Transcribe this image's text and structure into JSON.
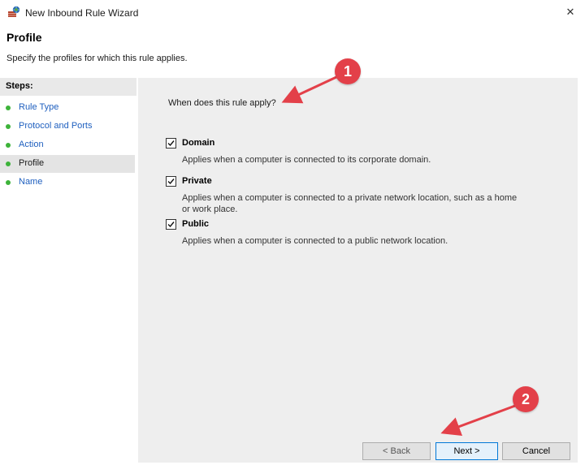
{
  "window": {
    "title": "New Inbound Rule Wizard",
    "close_glyph": "✕"
  },
  "page": {
    "title": "Profile",
    "subtitle": "Specify the profiles for which this rule applies."
  },
  "steps": {
    "header": "Steps:",
    "items": [
      {
        "label": "Rule Type",
        "current": false
      },
      {
        "label": "Protocol and Ports",
        "current": false
      },
      {
        "label": "Action",
        "current": false
      },
      {
        "label": "Profile",
        "current": true
      },
      {
        "label": "Name",
        "current": false
      }
    ]
  },
  "main": {
    "question": "When does this rule apply?",
    "options": [
      {
        "label": "Domain",
        "checked": true,
        "description": "Applies when a computer is connected to its corporate domain."
      },
      {
        "label": "Private",
        "checked": true,
        "description": "Applies when a computer is connected to a private network location, such as a home or work place."
      },
      {
        "label": "Public",
        "checked": true,
        "description": "Applies when a computer is connected to a public network location."
      }
    ]
  },
  "buttons": {
    "back": "< Back",
    "next": "Next >",
    "cancel": "Cancel"
  },
  "callouts": {
    "one": "1",
    "two": "2",
    "color": "#e34049"
  },
  "colors": {
    "step_dot": "#3db33a",
    "step_link": "#1e5fbf",
    "panel_bg": "#eeeeee"
  }
}
